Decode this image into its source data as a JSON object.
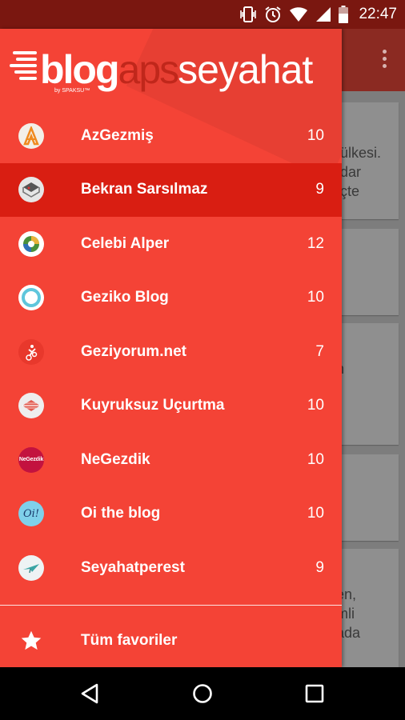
{
  "status_bar": {
    "time": "22:47",
    "icons": [
      "vibrate-icon",
      "alarm-icon",
      "wifi-icon",
      "signal-icon",
      "battery-icon"
    ]
  },
  "app": {
    "toolbar_overflow_icon": "overflow-menu-icon",
    "background_card_snippets": [
      "ülkesi.",
      "dar",
      "çte",
      "n",
      "en,",
      "mli",
      "ada"
    ]
  },
  "drawer": {
    "brand": {
      "part1": "blog",
      "part2": "aps",
      "part3": "seyahat",
      "byline": "by SPAKSU™"
    },
    "items": [
      {
        "label": "AzGezmiş",
        "count": "10",
        "active": false,
        "icon": "azgezmis-avatar-icon"
      },
      {
        "label": "Bekran Sarsılmaz",
        "count": "9",
        "active": true,
        "icon": "bekran-avatar-icon"
      },
      {
        "label": "Celebi Alper",
        "count": "12",
        "active": false,
        "icon": "celebi-avatar-icon"
      },
      {
        "label": "Geziko Blog",
        "count": "10",
        "active": false,
        "icon": "geziko-avatar-icon"
      },
      {
        "label": "Geziyorum.net",
        "count": "7",
        "active": false,
        "icon": "geziyorum-avatar-icon"
      },
      {
        "label": "Kuyruksuz Uçurtma",
        "count": "10",
        "active": false,
        "icon": "kuyruksuz-avatar-icon"
      },
      {
        "label": "NeGezdik",
        "count": "10",
        "active": false,
        "icon": "negezdik-avatar-icon",
        "avatar_text": "NeGezdik"
      },
      {
        "label": "Oi the blog",
        "count": "10",
        "active": false,
        "icon": "oi-avatar-icon",
        "avatar_text": "Oi!"
      },
      {
        "label": "Seyahatperest",
        "count": "9",
        "active": false,
        "icon": "seyahatperest-avatar-icon"
      }
    ],
    "favorites_label": "Tüm favoriler"
  },
  "nav_bar": {
    "icons": [
      "back-icon",
      "home-icon",
      "recents-icon"
    ]
  },
  "colors": {
    "drawer_bg": "#f44336",
    "active_row": "#d91e12",
    "status_bar": "#7a1710",
    "brand_accent": "#c0271b"
  }
}
